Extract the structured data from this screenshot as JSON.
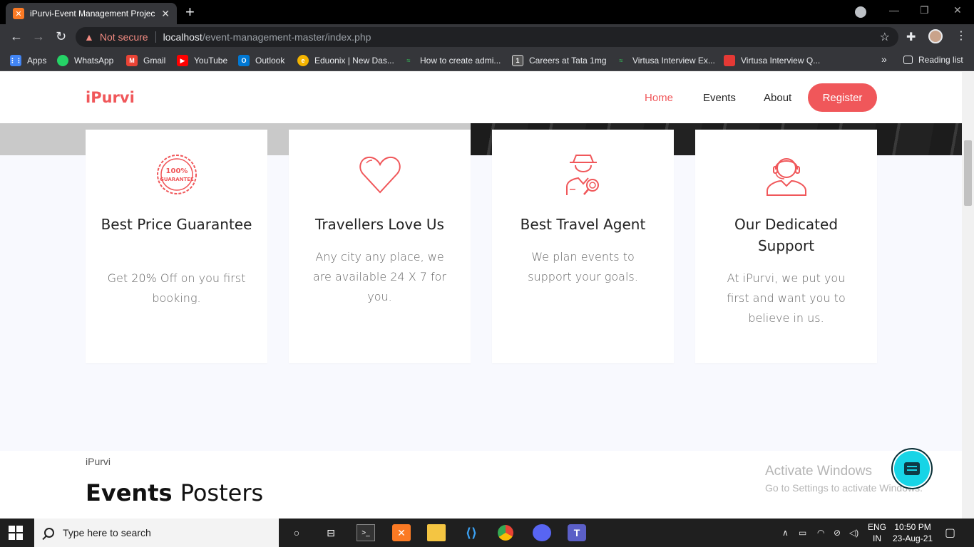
{
  "browser": {
    "tab_title": "iPurvi-Event Management Project",
    "tab_close": "✕",
    "new_tab": "+",
    "security_label": "Not secure",
    "url_host": "localhost",
    "url_path": "/event-management-master/index.php",
    "bookmarks": [
      {
        "label": "Apps",
        "icon": "apps-grid-icon",
        "color": "#4285f4"
      },
      {
        "label": "WhatsApp",
        "icon": "whatsapp-icon",
        "color": "#25d366"
      },
      {
        "label": "Gmail",
        "icon": "gmail-icon",
        "color": "#ea4335"
      },
      {
        "label": "YouTube",
        "icon": "youtube-icon",
        "color": "#ff0000"
      },
      {
        "label": "Outlook",
        "icon": "outlook-icon",
        "color": "#0078d4"
      },
      {
        "label": "Eduonix | New Das...",
        "icon": "eduonix-icon",
        "color": "#f4b400"
      },
      {
        "label": "How to create admi...",
        "icon": "link-icon",
        "color": "#34a853"
      },
      {
        "label": "Careers at Tata 1mg",
        "icon": "tata1mg-icon",
        "color": "#555555"
      },
      {
        "label": "Virtusa Interview Ex...",
        "icon": "link-icon",
        "color": "#34a853"
      },
      {
        "label": "Virtusa Interview Q...",
        "icon": "virtusa-icon",
        "color": "#e53935"
      }
    ],
    "more_bookmarks": "»",
    "reading_list": "Reading list"
  },
  "site": {
    "brand": "iPurvi",
    "nav": [
      {
        "label": "Home",
        "active": true
      },
      {
        "label": "Events",
        "active": false
      },
      {
        "label": "About",
        "active": false
      }
    ],
    "register_label": "Register",
    "accent_color": "#f0575a"
  },
  "features": [
    {
      "icon": "guarantee-badge-icon",
      "title": "Best Price Guarantee",
      "text": "Get 20% Off on you first booking.",
      "badge_line1": "100%",
      "badge_line2": "GUARANTEE"
    },
    {
      "icon": "heart-icon",
      "title": "Travellers Love Us",
      "text": "Any city any place, we are available 24 X 7 for you."
    },
    {
      "icon": "detective-agent-icon",
      "title": "Best Travel Agent",
      "text": "We plan events to support your goals."
    },
    {
      "icon": "support-headset-icon",
      "title": "Our Dedicated Support",
      "text": "At iPurvi, we put you first and want you to believe in us."
    }
  ],
  "events_section": {
    "subtitle": "iPurvi",
    "title_bold": "Events",
    "title_rest": "Posters"
  },
  "watermark": {
    "line1": "Activate Windows",
    "line2": "Go to Settings to activate Windows."
  },
  "taskbar": {
    "search_placeholder": "Type here to search",
    "language_line1": "ENG",
    "language_line2": "IN",
    "time": "10:50 PM",
    "date": "23-Aug-21"
  }
}
